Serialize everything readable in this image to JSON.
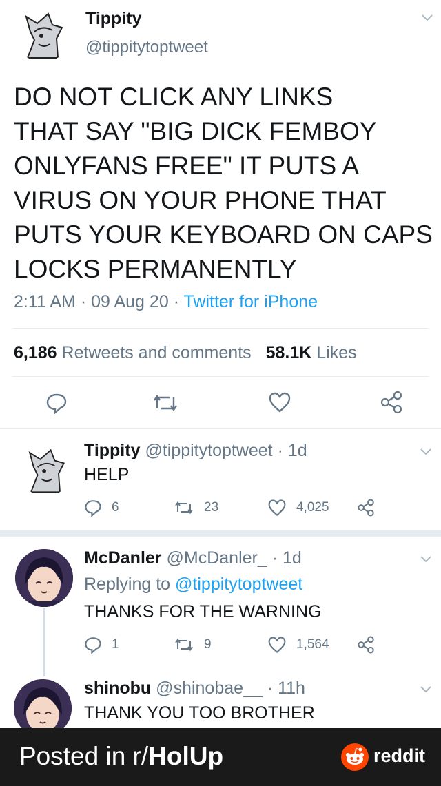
{
  "main_tweet": {
    "display_name": "Tippity",
    "handle": "@tippitytoptweet",
    "text_lines": [
      "DO NOT CLICK ANY LINKS",
      "THAT SAY \"BIG DICK FEMBOY",
      "ONLYFANS FREE\" IT PUTS A",
      "VIRUS ON YOUR PHONE THAT",
      "PUTS YOUR KEYBOARD ON CAPS",
      "LOCKS PERMANENTLY"
    ],
    "time": "2:11 AM",
    "date": "09 Aug 20",
    "source": "Twitter for iPhone",
    "retweets_count": "6,186",
    "retweets_label": "Retweets and comments",
    "likes_count": "58.1K",
    "likes_label": "Likes"
  },
  "replies": [
    {
      "display_name": "Tippity",
      "handle": "@tippitytoptweet",
      "age": "· 1d",
      "text": "HELP",
      "replies": "6",
      "retweets": "23",
      "likes": "4,025"
    },
    {
      "display_name": "McDanler",
      "handle": "@McDanler_",
      "age": "· 1d",
      "replying_label": "Replying to",
      "replying_to": "@tippitytoptweet",
      "text": "THANKS FOR THE WARNING",
      "replies": "1",
      "retweets": "9",
      "likes": "1,564"
    },
    {
      "display_name": "shinobu",
      "handle": "@shinobae__",
      "age": "· 11h",
      "text": "THANK YOU TOO BROTHER"
    }
  ],
  "footer": {
    "posted_in": "Posted in r/",
    "subreddit": "HolUp",
    "brand": "reddit"
  },
  "colors": {
    "link": "#1da1f2",
    "muted": "#657786",
    "reddit_orange": "#ff4500",
    "footer_bg": "#1a1a1b"
  }
}
